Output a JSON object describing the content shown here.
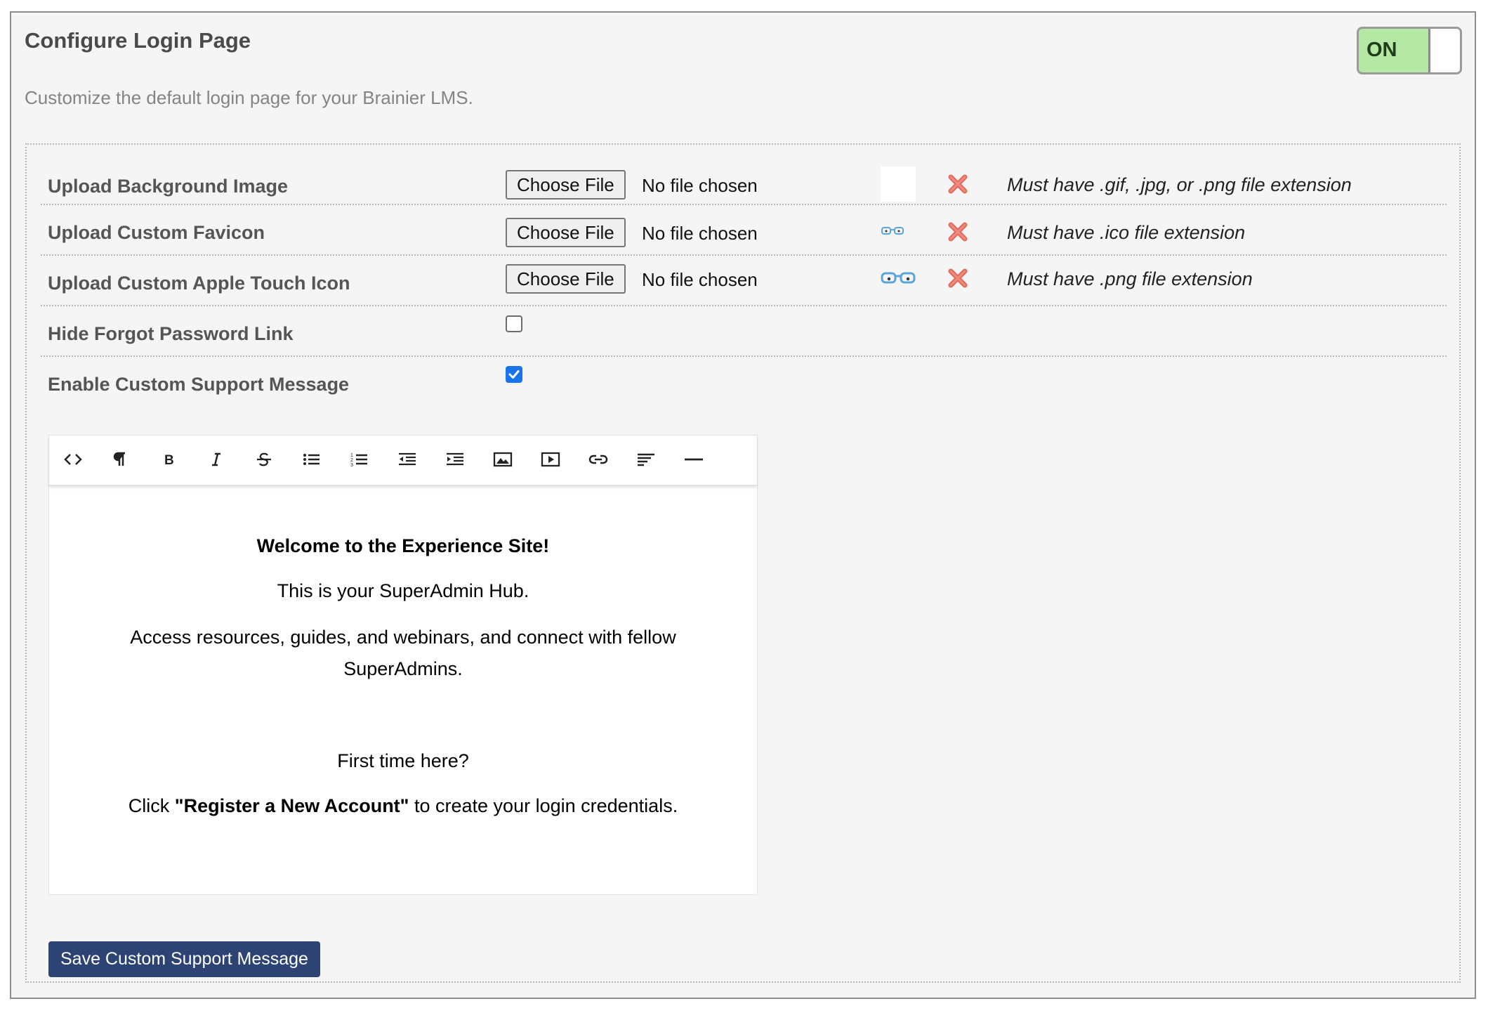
{
  "header": {
    "title": "Configure Login Page",
    "subtitle": "Customize the default login page for your Brainier LMS.",
    "toggle_label": "ON",
    "toggle_on": true
  },
  "uploads": [
    {
      "label": "Upload Background Image",
      "button_label": "Choose File",
      "status": "No file chosen",
      "hint": "Must have .gif, .jpg, or .png file extension"
    },
    {
      "label": "Upload Custom Favicon",
      "button_label": "Choose File",
      "status": "No file chosen",
      "hint": "Must have .ico file extension"
    },
    {
      "label": "Upload Custom Apple Touch Icon",
      "button_label": "Choose File",
      "status": "No file chosen",
      "hint": "Must have .png file extension"
    }
  ],
  "options": [
    {
      "label": "Hide Forgot Password Link",
      "checked": false
    },
    {
      "label": "Enable Custom Support Message",
      "checked": true
    }
  ],
  "editor": {
    "toolbar": [
      "code-view-icon",
      "paragraph-icon",
      "bold-icon",
      "italic-icon",
      "strikethrough-icon",
      "bulleted-list-icon",
      "numbered-list-icon",
      "outdent-icon",
      "indent-icon",
      "image-icon",
      "video-icon",
      "link-icon",
      "align-left-icon",
      "horizontal-rule-icon"
    ],
    "heading": "Welcome to the Experience Site!",
    "line1": "This is your SuperAdmin Hub.",
    "line2a": "Access resources, guides, and webinars, and connect with fellow",
    "line2b": "SuperAdmins.",
    "line3": "First time here?",
    "line4_prefix": "Click ",
    "line4_bold": "\"Register a New Account\"",
    "line4_suffix": " to create your login credentials."
  },
  "save_button_label": "Save Custom Support Message",
  "colors": {
    "toggle_bg": "#b5e8a4",
    "save_button_bg": "#2c4373",
    "remove_icon": "#e06b5d",
    "checkbox_checked": "#1a73e8",
    "glasses_icon": "#5aa6d8"
  }
}
